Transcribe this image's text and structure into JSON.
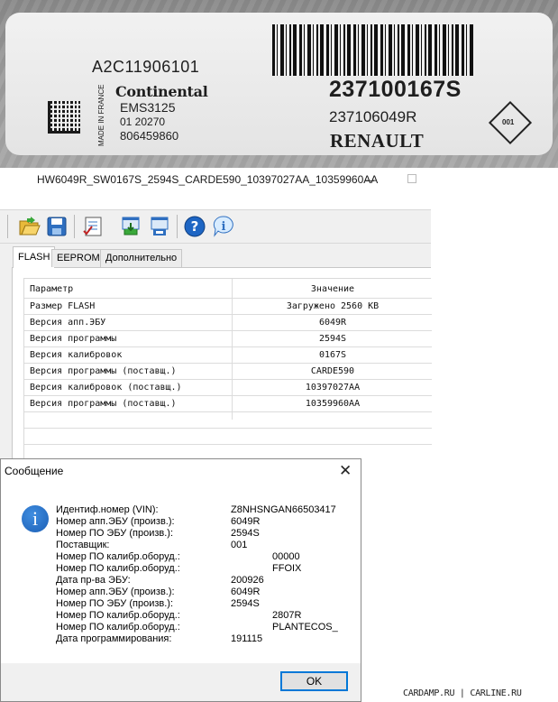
{
  "sticker": {
    "supplier_code": "A2C11906101",
    "brand": "Continental",
    "ecu_model": "EMS3125",
    "line1": "01 20270",
    "line2": "806459860",
    "made_in": "MADE IN FRANCE",
    "renault_number_big": "237100167S",
    "renault_number_small": "237106049R",
    "maker": "RENAULT",
    "diamond_code": "001"
  },
  "window": {
    "title": "HW6049R_SW0167S_2594S_CARDE590_10397027AA_10359960AA"
  },
  "toolbar": {
    "icons": [
      "open-folder-icon",
      "save-icon",
      "checklist-icon",
      "read-icon",
      "write-icon",
      "help-icon",
      "info-icon"
    ]
  },
  "tabs": [
    {
      "label": "FLASH"
    },
    {
      "label": "EEPROM"
    },
    {
      "label": "Дополнительно"
    }
  ],
  "grid": {
    "headers": [
      "Параметр",
      "Значение"
    ],
    "rows": [
      {
        "param": "Размер FLASH",
        "value": "Загружено 2560 KB"
      },
      {
        "param": "Версия апп.ЭБУ",
        "value": "6049R"
      },
      {
        "param": "Версия программы",
        "value": "2594S"
      },
      {
        "param": "Версия калибровок",
        "value": "0167S"
      },
      {
        "param": "Версия программы (поставщ.)",
        "value": "CARDE590"
      },
      {
        "param": "Версия калибровок (поставщ.)",
        "value": "10397027AA"
      },
      {
        "param": "Версия программы (поставщ.)",
        "value": "10359960AA"
      }
    ]
  },
  "dialog": {
    "title": "Сообщение",
    "lines": [
      {
        "label": "Идентиф.номер (VIN):",
        "value": "Z8NHSNGAN66503417"
      },
      {
        "label": "Номер апп.ЭБУ (произв.):",
        "value": "6049R"
      },
      {
        "label": "Номер ПО ЭБУ (произв.):",
        "value": "2594S"
      },
      {
        "label": "Поставщик:",
        "value": "001"
      },
      {
        "label": "Номер ПО калибр.оборуд.:",
        "value": "00000"
      },
      {
        "label": "Номер ПО калибр.оборуд.:",
        "value": "FFOIX"
      },
      {
        "label": "Дата пр-ва ЭБУ:",
        "value": "200926"
      },
      {
        "label": "Номер апп.ЭБУ (произв.):",
        "value": "6049R"
      },
      {
        "label": "Номер ПО ЭБУ (произв.):",
        "value": "2594S"
      },
      {
        "label": "Номер ПО калибр.оборуд.:",
        "value": "2807R"
      },
      {
        "label": "Номер ПО калибр.оборуд.:",
        "value": "PLANTECOS_"
      },
      {
        "label": "Дата программирования:",
        "value": "191115"
      }
    ],
    "ok_label": "OK"
  },
  "watermark": "CARDAMP.RU | CARLINE.RU"
}
